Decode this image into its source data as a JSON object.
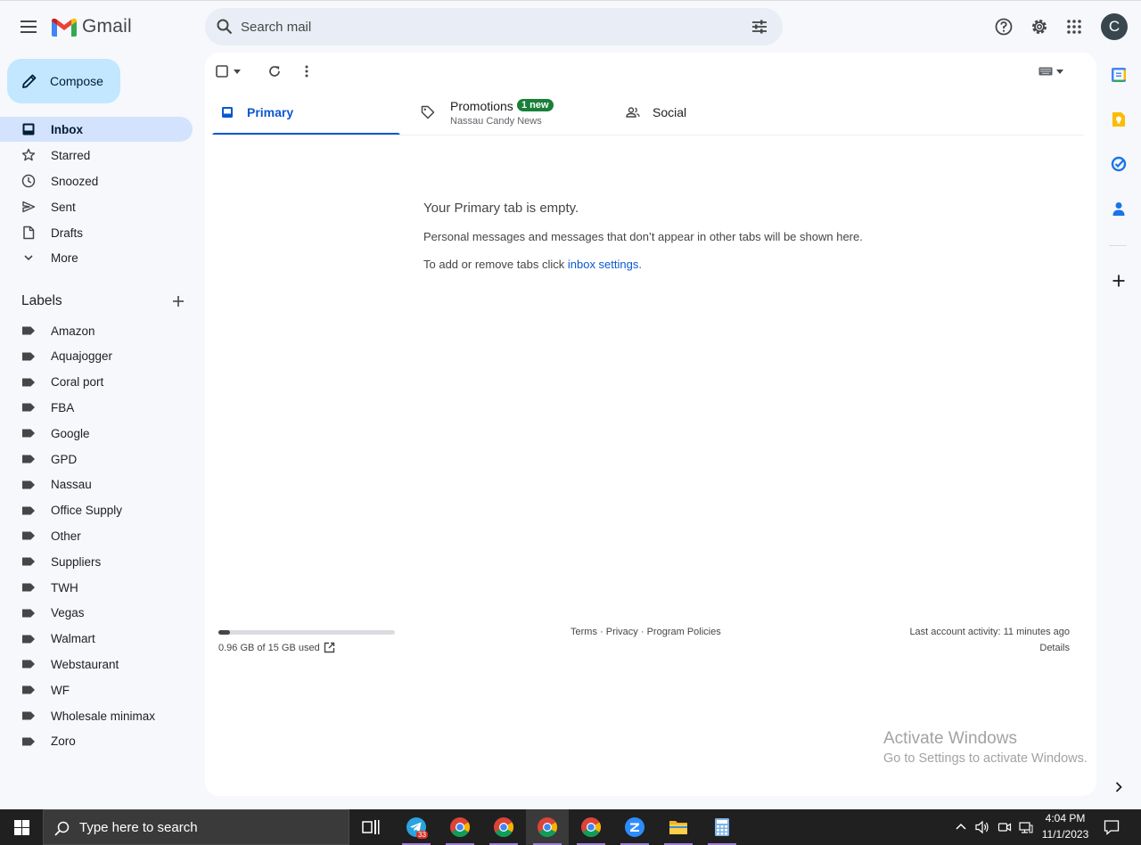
{
  "app": {
    "name": "Gmail"
  },
  "search": {
    "placeholder": "Search mail"
  },
  "account": {
    "initial": "C"
  },
  "compose": {
    "label": "Compose"
  },
  "nav": [
    {
      "label": "Inbox",
      "icon": "inbox-icon",
      "active": true
    },
    {
      "label": "Starred",
      "icon": "star-icon"
    },
    {
      "label": "Snoozed",
      "icon": "clock-icon"
    },
    {
      "label": "Sent",
      "icon": "send-icon"
    },
    {
      "label": "Drafts",
      "icon": "draft-icon"
    },
    {
      "label": "More",
      "icon": "chevron-down-icon"
    }
  ],
  "labels": {
    "title": "Labels",
    "items": [
      "Amazon",
      "Aquajogger",
      "Coral port",
      "FBA",
      "Google",
      "GPD",
      "Nassau",
      "Office Supply",
      "Other",
      "Suppliers",
      "TWH",
      "Vegas",
      "Walmart",
      "Webstaurant",
      "WF",
      "Wholesale minimax",
      "Zoro"
    ]
  },
  "tabs": {
    "primary": "Primary",
    "promotions": "Promotions",
    "promotions_badge": "1 new",
    "promotions_sub": "Nassau Candy News",
    "social": "Social"
  },
  "empty": {
    "title": "Your Primary tab is empty.",
    "description": "Personal messages and messages that don’t appear in other tabs will be shown here.",
    "tabs_prefix": "To add or remove tabs click ",
    "tabs_link": "inbox settings."
  },
  "footer": {
    "storage_text": "0.96 GB of 15 GB used",
    "storage_fraction": 0.064,
    "terms": "Terms",
    "privacy": "Privacy",
    "policies": "Program Policies",
    "sep": " · ",
    "activity": "Last account activity: 11 minutes ago",
    "details": "Details"
  },
  "watermark": {
    "line1": "Activate Windows",
    "line2": "Go to Settings to activate Windows."
  },
  "taskbar": {
    "search_placeholder": "Type here to search",
    "telegram_badge": "33",
    "time": "4:04 PM",
    "date": "11/1/2023"
  },
  "colors": {
    "accent": "#0b57d0",
    "compose_bg": "#c2e7ff",
    "active_nav": "#d3e3fd",
    "badge": "#188038"
  }
}
